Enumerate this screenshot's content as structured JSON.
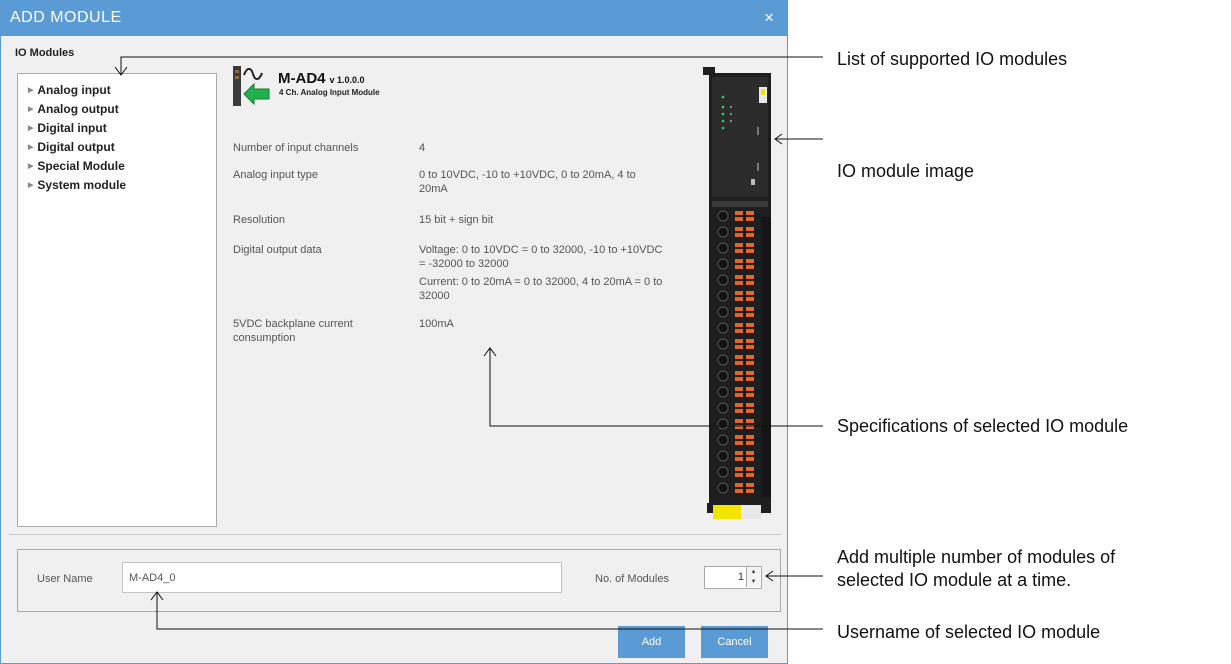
{
  "dialog": {
    "title": "ADD MODULE",
    "close_glyph": "×",
    "section_label": "IO Modules"
  },
  "tree": {
    "items": [
      {
        "label": "Analog input"
      },
      {
        "label": "Analog output"
      },
      {
        "label": "Digital input"
      },
      {
        "label": "Digital output"
      },
      {
        "label": "Special Module"
      },
      {
        "label": "System module"
      }
    ],
    "arrow_glyph": "▶"
  },
  "module": {
    "name": "M-AD4",
    "version": "v 1.0.0.0",
    "description": "4 Ch. Analog Input Module",
    "icon": "analog-input-module-icon"
  },
  "specs": [
    {
      "label": "Number of input channels",
      "value": "4"
    },
    {
      "label": "Analog input type",
      "value": "0 to 10VDC, -10 to +10VDC, 0 to 20mA, 4 to 20mA"
    },
    {
      "label": "Resolution",
      "value": "15 bit + sign bit"
    },
    {
      "label": "Digital output data",
      "value": "Voltage: 0 to 10VDC = 0 to 32000, -10 to +10VDC = -32000 to 32000"
    },
    {
      "label": "",
      "value": "Current: 0 to 20mA = 0 to 32000, 4 to 20mA = 0 to 32000"
    },
    {
      "label": "5VDC backplane current consumption",
      "value": "100mA"
    }
  ],
  "form": {
    "user_name_label": "User Name",
    "user_name_value": "M-AD4_0",
    "modules_label": "No. of Modules",
    "modules_value": "1",
    "spin_up_glyph": "▲",
    "spin_down_glyph": "▼"
  },
  "buttons": {
    "add": "Add",
    "cancel": "Cancel"
  },
  "annotations": {
    "list": "List of supported IO modules",
    "image": "IO module image",
    "specs": "Specifications of selected IO module",
    "multiple_line1": "Add multiple number of modules of",
    "multiple_line2": "selected IO module at a time.",
    "username": "Username of selected IO module"
  },
  "colors": {
    "accent": "#5b9bd5",
    "module_body": "#1e1e1e",
    "terminal": "#e0662a",
    "label_yellow": "#f2e600",
    "icon_green": "#22b14c"
  }
}
